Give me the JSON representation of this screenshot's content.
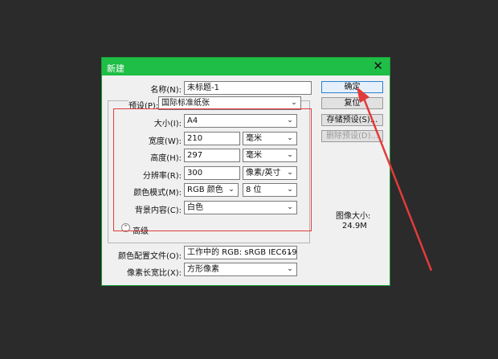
{
  "dialog": {
    "title": "新建",
    "close_glyph": "✕",
    "name_label": "名称(N):",
    "name_value": "未标题-1",
    "preset_label": "预设(P):",
    "preset_value": "国际标准纸张",
    "size_label": "大小(I):",
    "size_value": "A4",
    "width_label": "宽度(W):",
    "width_value": "210",
    "width_unit": "毫米",
    "height_label": "高度(H):",
    "height_value": "297",
    "height_unit": "毫米",
    "resolution_label": "分辨率(R):",
    "resolution_value": "300",
    "resolution_unit": "像素/英寸",
    "color_mode_label": "颜色模式(M):",
    "color_mode_value": "RGB 颜色",
    "bit_depth_value": "8 位",
    "background_label": "背景内容(C):",
    "background_value": "白色",
    "advanced_label": "高级",
    "color_profile_label": "颜色配置文件(O):",
    "color_profile_value": "工作中的 RGB: sRGB IEC619...",
    "pixel_aspect_label": "像素长宽比(X):",
    "pixel_aspect_value": "方形像素",
    "image_size_label": "图像大小:",
    "image_size_value": "24.9M"
  },
  "buttons": {
    "ok": "确定",
    "reset": "复位",
    "save_preset": "存储预设(S)...",
    "delete_preset": "删除预设(D)..."
  },
  "icons": {
    "caret": "⌄",
    "advanced": "⌃"
  },
  "colors": {
    "titlebar": "#1fbe47",
    "annotation_red": "#e23b3b"
  }
}
